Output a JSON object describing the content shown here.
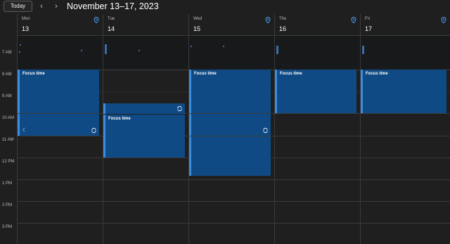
{
  "toolbar": {
    "today_label": "Today",
    "prev_icon": "chevron-left-icon",
    "next_icon": "chevron-right-icon",
    "range_title": "November 13–17, 2023",
    "caret_icon": "chevron-down-icon"
  },
  "days": [
    {
      "name": "Mon",
      "num": "13"
    },
    {
      "name": "Tue",
      "num": "14"
    },
    {
      "name": "Wed",
      "num": "15"
    },
    {
      "name": "Thu",
      "num": "16"
    },
    {
      "name": "Fri",
      "num": "17"
    }
  ],
  "time_labels": [
    "7 AM",
    "8 AM",
    "9 AM",
    "10 AM",
    "11 AM",
    "12 PM",
    "1 PM",
    "2 PM",
    "3 PM"
  ],
  "events": {
    "mon_focus": "Focus time",
    "tue_focus": "Focus time",
    "wed_focus": "Focus time",
    "thu_focus": "Focus time",
    "fri_focus": "Focus time"
  },
  "colors": {
    "background": "#1f1f1f",
    "event_fill": "#0f4a84",
    "event_accent": "#3b8de0"
  }
}
